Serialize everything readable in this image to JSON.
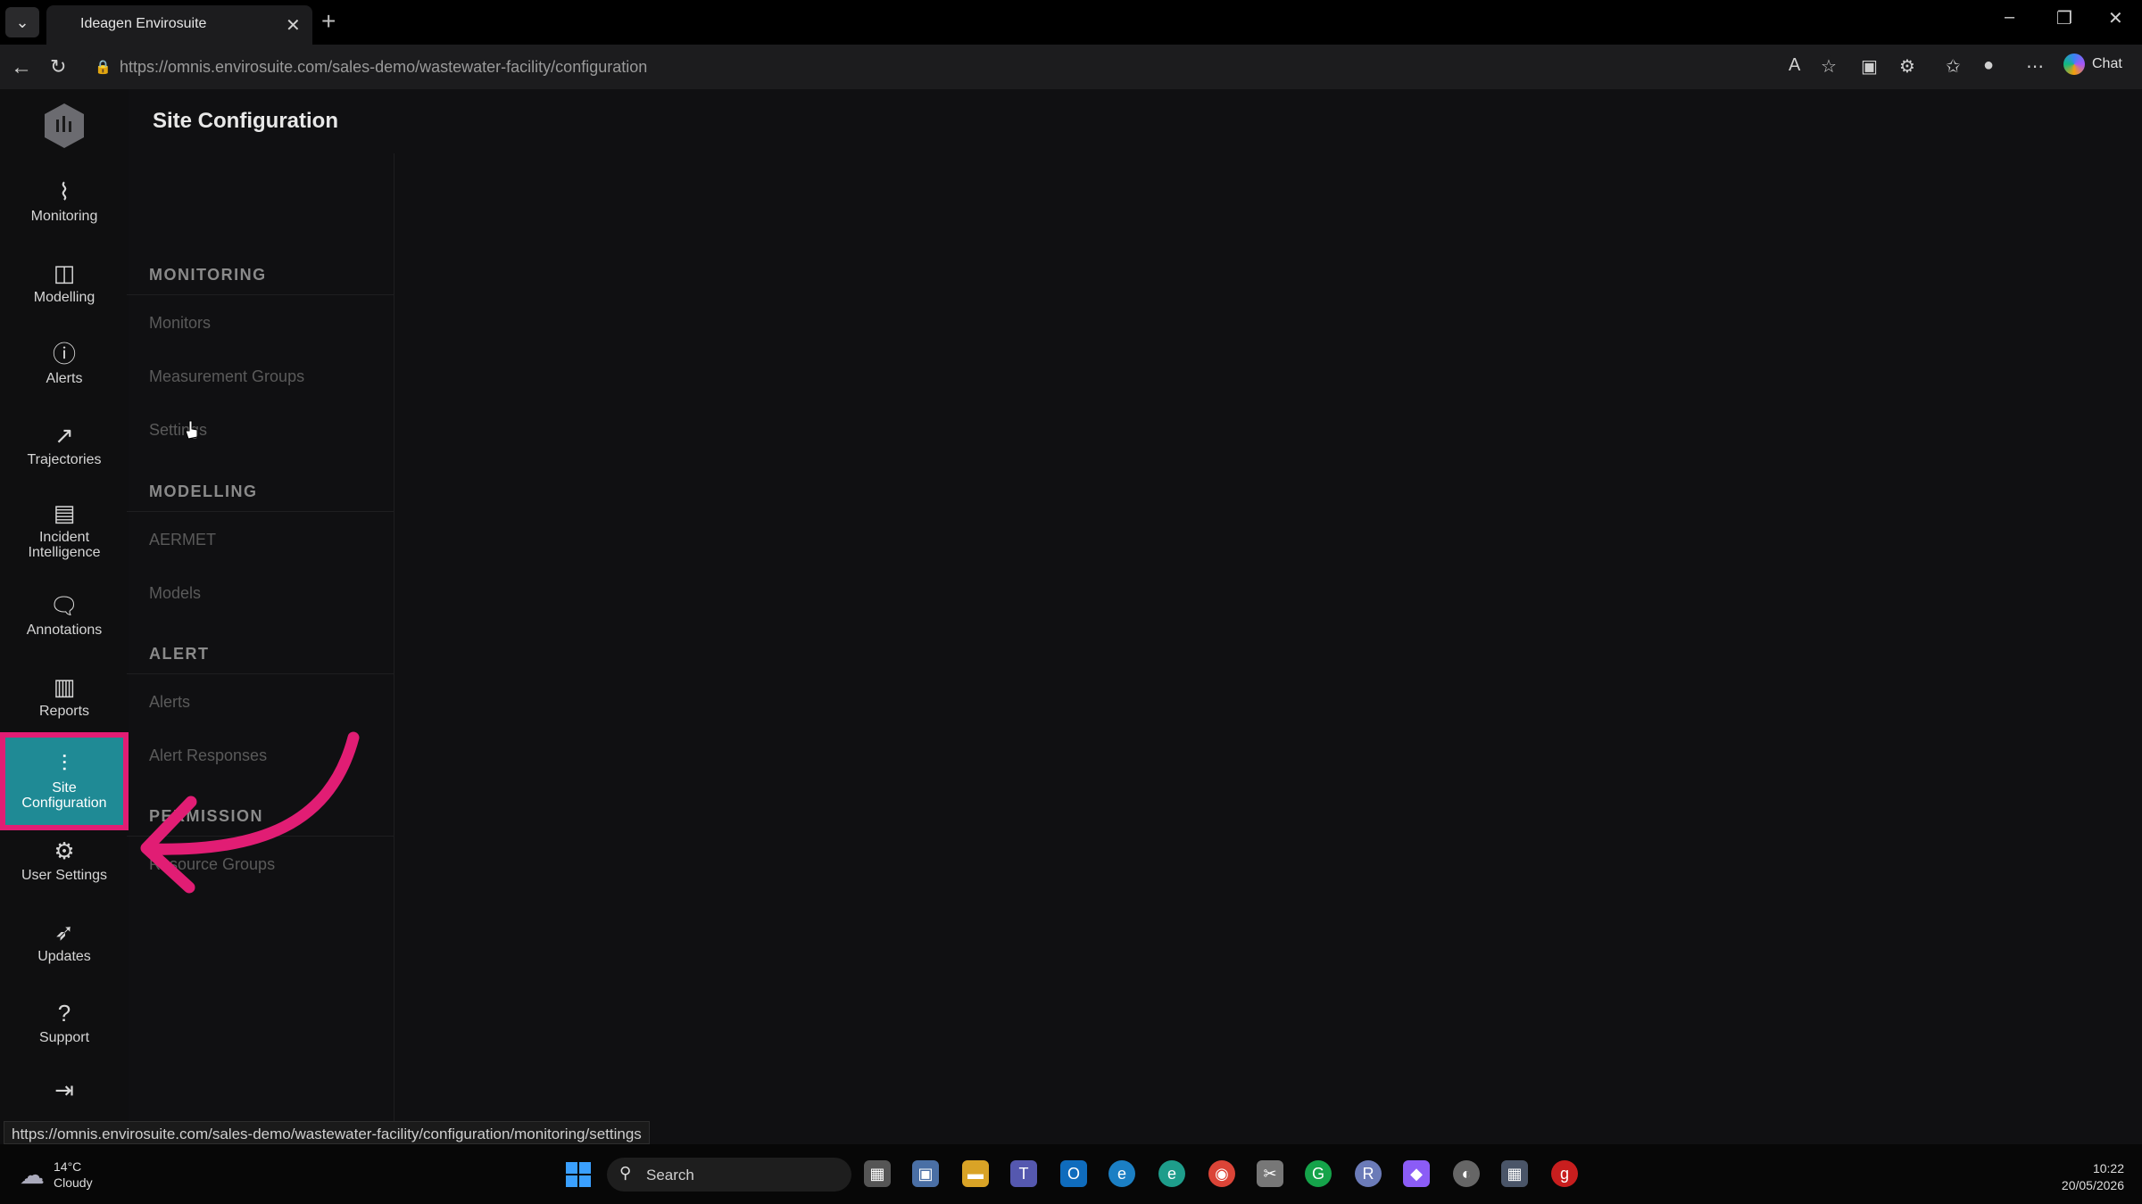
{
  "browser": {
    "tab_title": "Ideagen Envirosuite",
    "url": "https://omnis.envirosuite.com/sales-demo/wastewater-facility/configuration",
    "chat_label": "Chat",
    "status_url": "https://omnis.envirosuite.com/sales-demo/wastewater-facility/configuration/monitoring/settings"
  },
  "rail": {
    "items": [
      {
        "label": "Monitoring",
        "icon": "activity-icon"
      },
      {
        "label": "Modelling",
        "icon": "layout-icon"
      },
      {
        "label": "Alerts",
        "icon": "alert-icon"
      },
      {
        "label": "Trajectories",
        "icon": "trajectory-icon"
      },
      {
        "label": "Incident",
        "label2": "Intelligence",
        "icon": "incident-icon"
      },
      {
        "label": "Annotations",
        "icon": "annotation-icon"
      },
      {
        "label": "Reports",
        "icon": "reports-icon"
      },
      {
        "label": "Site",
        "label2": "Configuration",
        "icon": "sliders-icon"
      },
      {
        "label": "User Settings",
        "icon": "gear-icon"
      },
      {
        "label": "Updates",
        "icon": "rocket-icon"
      },
      {
        "label": "Support",
        "icon": "help-icon"
      }
    ]
  },
  "page": {
    "title": "Site Configuration"
  },
  "subnav": {
    "monitoring": {
      "heading": "MONITORING",
      "items": [
        "Monitors",
        "Measurement Groups",
        "Settings"
      ]
    },
    "modelling": {
      "heading": "MODELLING",
      "items": [
        "AERMET",
        "Models"
      ]
    },
    "alert": {
      "heading": "ALERT",
      "items": [
        "Alerts",
        "Alert Responses"
      ]
    },
    "permission": {
      "heading": "PERMISSION",
      "items": [
        "Resource Groups"
      ]
    }
  },
  "taskbar": {
    "temp": "14°C",
    "weather": "Cloudy",
    "search_placeholder": "Search",
    "time": "10:22",
    "date": "20/05/2026"
  },
  "colors": {
    "accent": "#1f8a95",
    "highlight": "#e11d74"
  }
}
